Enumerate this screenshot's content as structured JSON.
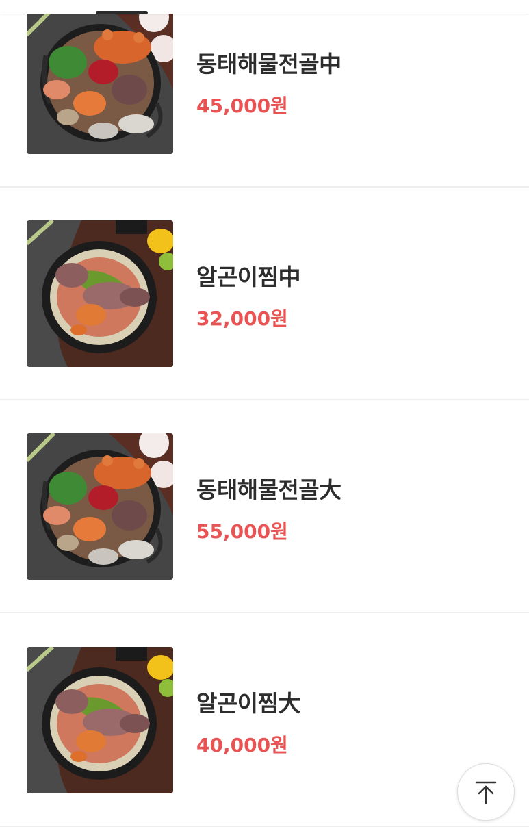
{
  "menu": {
    "items": [
      {
        "name": "동태해물전골中",
        "price": "45,000원",
        "image": "jeongol-photo"
      },
      {
        "name": "알곤이찜中",
        "price": "32,000원",
        "image": "jjim-photo"
      },
      {
        "name": "동태해물전골大",
        "price": "55,000원",
        "image": "jeongol-photo"
      },
      {
        "name": "알곤이찜大",
        "price": "40,000원",
        "image": "jjim-photo"
      }
    ]
  },
  "colors": {
    "price": "#ea5353",
    "name": "#2d2d2d",
    "divider": "#eeeeee"
  },
  "scroll_top_button": {
    "icon": "arrow-up-to-top-icon"
  }
}
